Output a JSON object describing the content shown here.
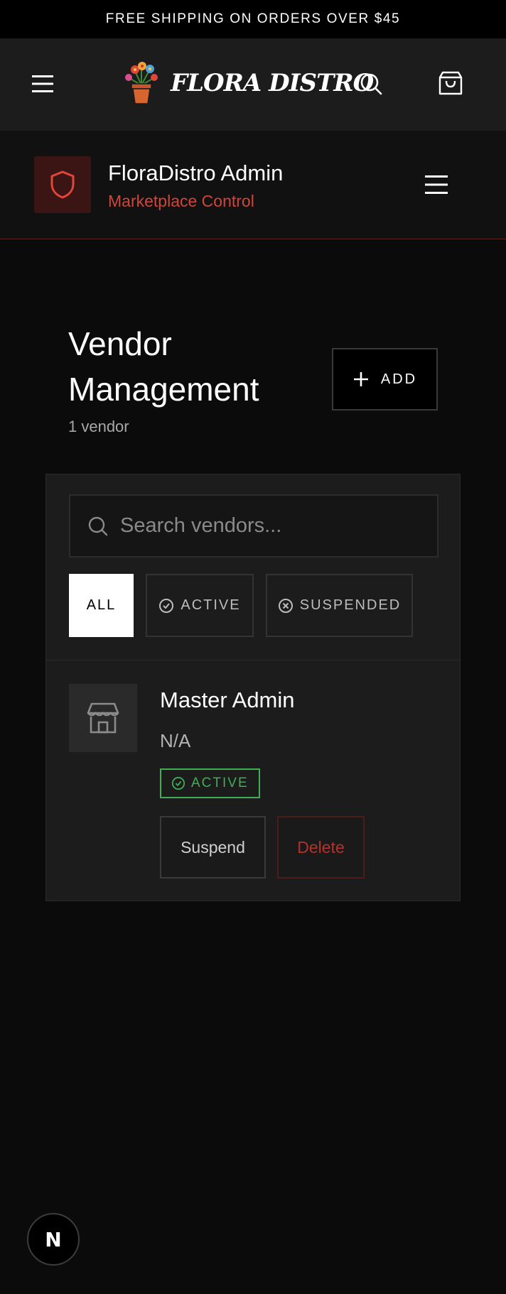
{
  "banner": {
    "text": "FREE SHIPPING ON ORDERS OVER $45"
  },
  "nav": {
    "logo_text": "FLORA DISTRO",
    "icons": [
      "menu-icon",
      "search-icon",
      "shopping-bag-icon"
    ]
  },
  "admin": {
    "title": "FloraDistro Admin",
    "subtitle": "Marketplace Control",
    "icons": [
      "shield-icon",
      "menu-icon"
    ],
    "accent_color": "#d1453b"
  },
  "page": {
    "title": "Vendor Management",
    "count": "1 vendor",
    "add_label": "ADD"
  },
  "search": {
    "placeholder": "Search vendors...",
    "value": ""
  },
  "filters": [
    {
      "label": "ALL",
      "selected": true
    },
    {
      "label": "ACTIVE",
      "icon": "check-circle-icon",
      "selected": false
    },
    {
      "label": "SUSPENDED",
      "icon": "x-circle-icon",
      "selected": false
    }
  ],
  "vendors": [
    {
      "name": "Master Admin",
      "email": "N/A",
      "status": "ACTIVE",
      "icon": "store-icon",
      "actions": {
        "suspend": "Suspend",
        "delete": "Delete"
      }
    }
  ],
  "colors": {
    "active_green": "#3fae55",
    "danger_red": "#b3332c",
    "background": "#0b0b0b"
  },
  "dev_badge": {
    "text": "N"
  }
}
